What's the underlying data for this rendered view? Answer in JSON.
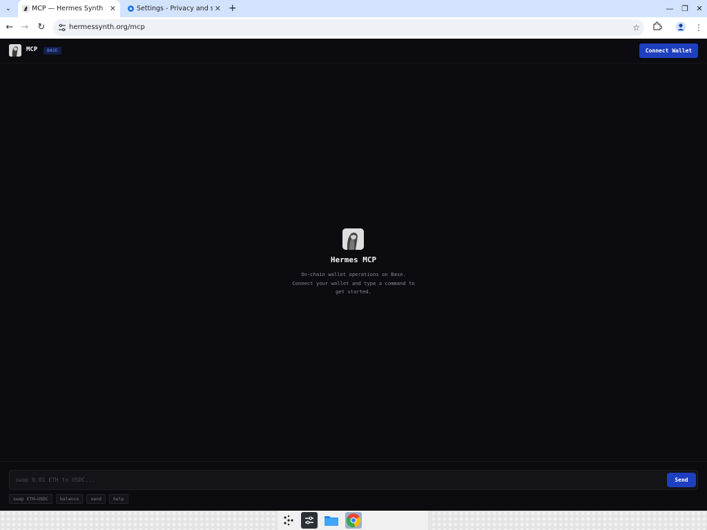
{
  "browser": {
    "tabs": [
      {
        "title": "MCP — Hermes Synth",
        "active": true
      },
      {
        "title": "Settings - Privacy and security",
        "active": false
      }
    ],
    "url": "hermessynth.org/mcp"
  },
  "header": {
    "brand": "MCP",
    "network_badge": "BASE",
    "connect_label": "Connect Wallet"
  },
  "hero": {
    "title": "Hermes MCP",
    "lines": [
      "On-chain wallet operations on Base.",
      "Connect your wallet and type a command to",
      "get started."
    ]
  },
  "footer": {
    "input_placeholder": "swap 0.01 ETH to USDC...",
    "send_label": "Send",
    "suggestions": [
      "swap ETH→USDC",
      "balance",
      "send",
      "help"
    ]
  },
  "colors": {
    "accent": "#1e3fbf",
    "background": "#0b0b10"
  }
}
